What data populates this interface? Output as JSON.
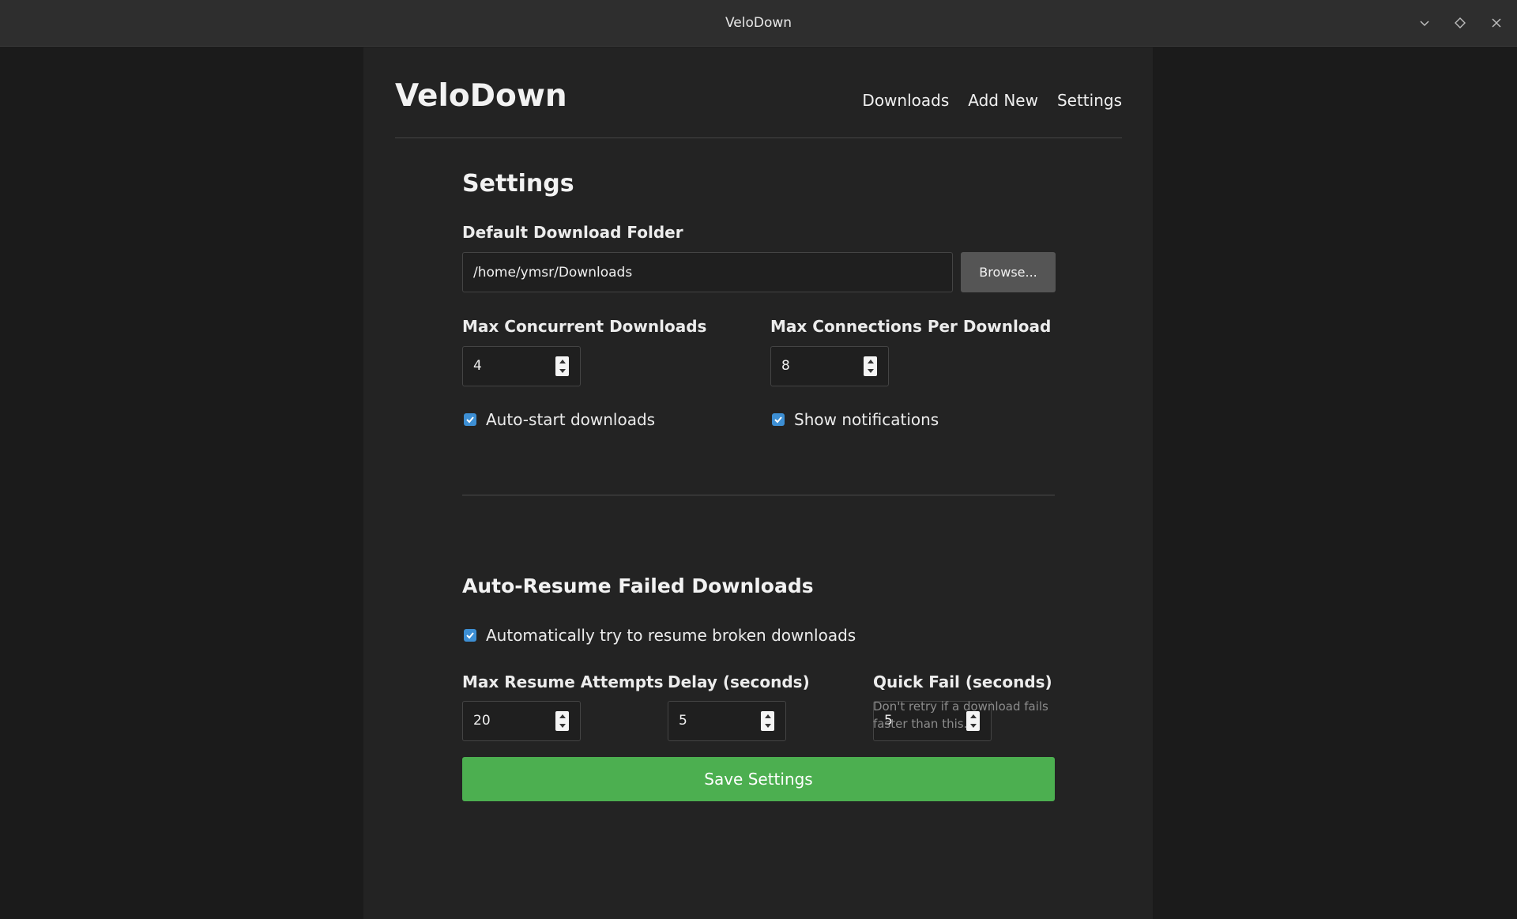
{
  "window": {
    "title": "VeloDown",
    "controls": [
      "minimize-icon",
      "maximize-icon",
      "close-icon"
    ]
  },
  "app": {
    "brand": "VeloDown",
    "nav": [
      "Downloads",
      "Add New",
      "Settings"
    ]
  },
  "settings": {
    "heading": "Settings",
    "folder_label": "Default Download Folder",
    "folder_value": "/home/ymsr/Downloads",
    "browse_label": "Browse...",
    "max_concurrent_label": "Max Concurrent Downloads",
    "max_concurrent_value": "4",
    "max_connections_label": "Max Connections Per Download",
    "max_connections_value": "8",
    "auto_start_label": "Auto-start downloads",
    "auto_start_checked": true,
    "notifications_label": "Show notifications",
    "notifications_checked": true
  },
  "auto_resume": {
    "heading": "Auto-Resume Failed Downloads",
    "enable_label": "Automatically try to resume broken downloads",
    "enable_checked": true,
    "max_attempts_label": "Max Resume Attempts",
    "max_attempts_value": "20",
    "delay_label": "Delay (seconds)",
    "delay_value": "5",
    "quick_fail_label": "Quick Fail (seconds)",
    "quick_fail_value": "5",
    "quick_fail_hint": "Don't retry if a download fails faster than this."
  },
  "save_label": "Save Settings",
  "colors": {
    "accent_green": "#4caf50",
    "checkbox_blue": "#3d8fd4",
    "background": "#1b1b1b",
    "panel": "#232323"
  }
}
